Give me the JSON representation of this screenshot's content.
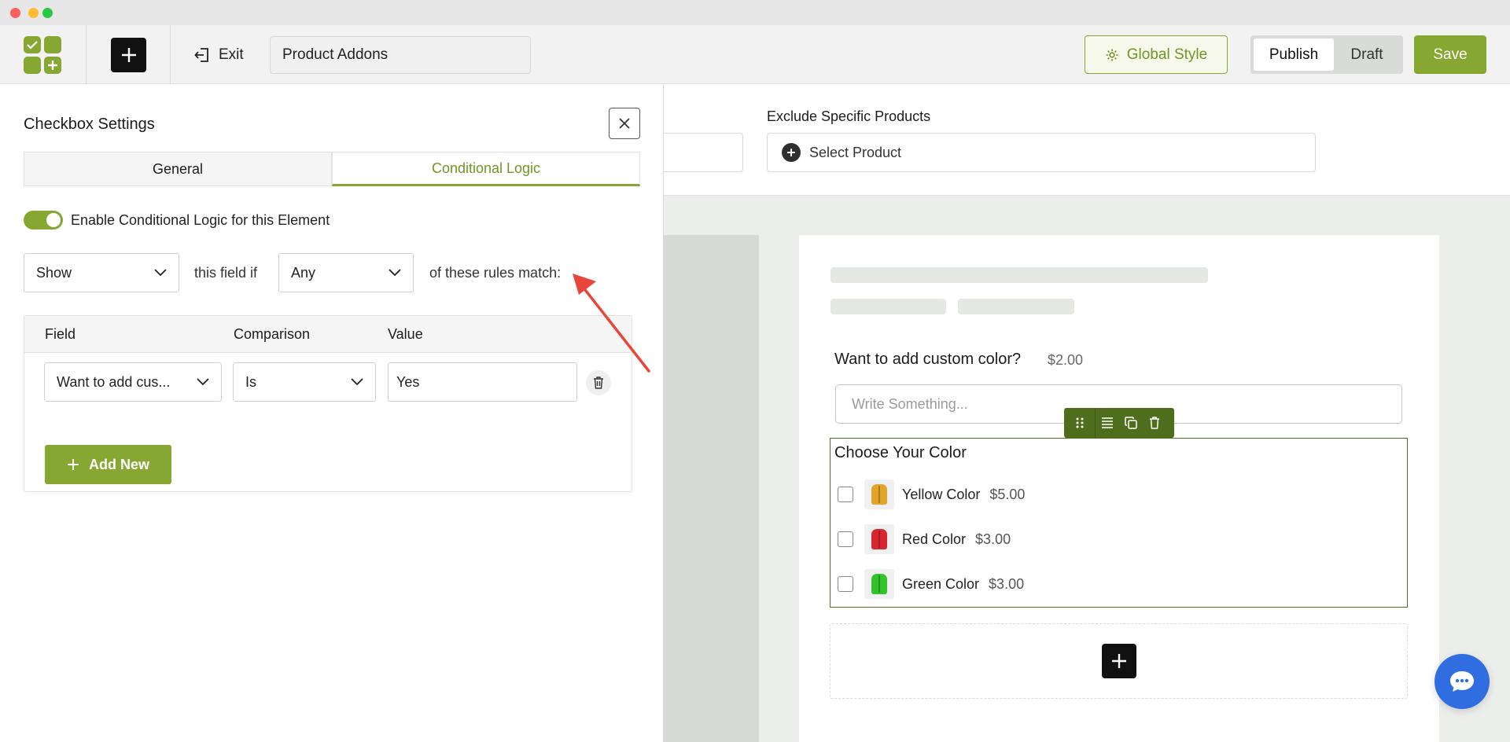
{
  "window": {
    "controls": [
      "close",
      "minimize",
      "zoom"
    ]
  },
  "topbar": {
    "add_icon": "plus-icon",
    "exit_label": "Exit",
    "form_title": "Product Addons",
    "global_style_label": "Global Style",
    "publish_label": "Publish",
    "draft_label": "Draft",
    "save_label": "Save",
    "accent_color": "#86a832"
  },
  "background": {
    "exclude_label": "Exclude Specific Products",
    "select_product_label": "Select Product"
  },
  "preview": {
    "text_field": {
      "label": "Want to add custom color?",
      "price": "$2.00",
      "placeholder": "Write Something..."
    },
    "checkbox_field": {
      "title": "Choose Your Color",
      "options": [
        {
          "label": "Yellow Color",
          "price": "$5.00",
          "color": "#e0a52a"
        },
        {
          "label": "Red Color",
          "price": "$3.00",
          "color": "#d8262f"
        },
        {
          "label": "Green Color",
          "price": "$3.00",
          "color": "#34c22b"
        }
      ]
    },
    "toolbar_icons": [
      "drag-handle-icon",
      "align-icon",
      "duplicate-icon",
      "trash-icon"
    ]
  },
  "panel": {
    "title": "Checkbox Settings",
    "tabs": [
      {
        "label": "General",
        "active": false
      },
      {
        "label": "Conditional Logic",
        "active": true
      }
    ],
    "toggle_label": "Enable Conditional Logic for this Element",
    "toggle_on": true,
    "action_select": "Show",
    "text_field_if": "this field if",
    "match_select": "Any",
    "text_rules_match": "of these rules match:",
    "rules": {
      "headers": [
        "Field",
        "Comparison",
        "Value"
      ],
      "rows": [
        {
          "field": "Want to add cus...",
          "comparison": "Is",
          "value": "Yes"
        }
      ]
    },
    "add_new_label": "Add New"
  },
  "annotation": {
    "arrow_color": "#e8463a"
  }
}
